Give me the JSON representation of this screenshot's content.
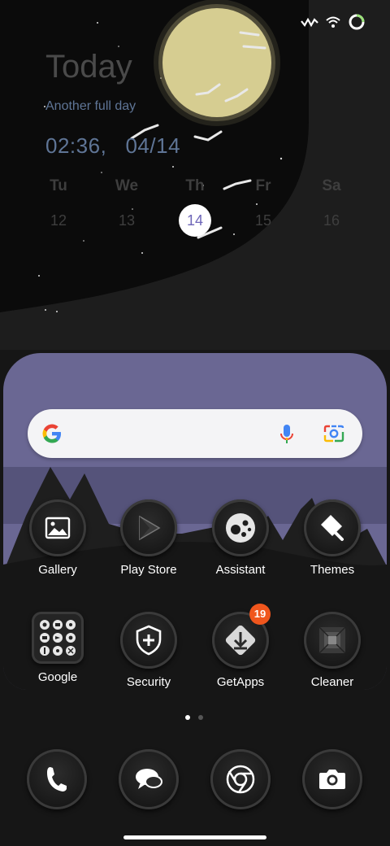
{
  "widget": {
    "title": "Today",
    "subtitle": "Another full day",
    "time": "02:36,",
    "date": "04/14",
    "days": [
      "Tu",
      "We",
      "Th",
      "Fr",
      "Sa"
    ],
    "dates": [
      "12",
      "13",
      "14",
      "15",
      "16"
    ],
    "selected_index": 2
  },
  "home": {
    "apps_row1": [
      {
        "label": "Gallery",
        "icon": "gallery-icon"
      },
      {
        "label": "Play Store",
        "icon": "play-store-icon"
      },
      {
        "label": "Assistant",
        "icon": "assistant-icon"
      },
      {
        "label": "Themes",
        "icon": "themes-icon"
      }
    ],
    "apps_row2": [
      {
        "label": "Google",
        "icon": "google-folder-icon"
      },
      {
        "label": "Security",
        "icon": "security-icon"
      },
      {
        "label": "GetApps",
        "icon": "getapps-icon",
        "badge": "19"
      },
      {
        "label": "Cleaner",
        "icon": "cleaner-icon"
      }
    ]
  },
  "dock": [
    "phone-icon",
    "messages-icon",
    "chrome-icon",
    "camera-icon"
  ],
  "page_indicator": {
    "count": 2,
    "active": 0
  },
  "colors": {
    "panel": "#6a6793",
    "badge": "#f0561d",
    "moon": "#d6cd91",
    "sky": "#0b0b0b",
    "accent_date": "#6e66b8"
  }
}
